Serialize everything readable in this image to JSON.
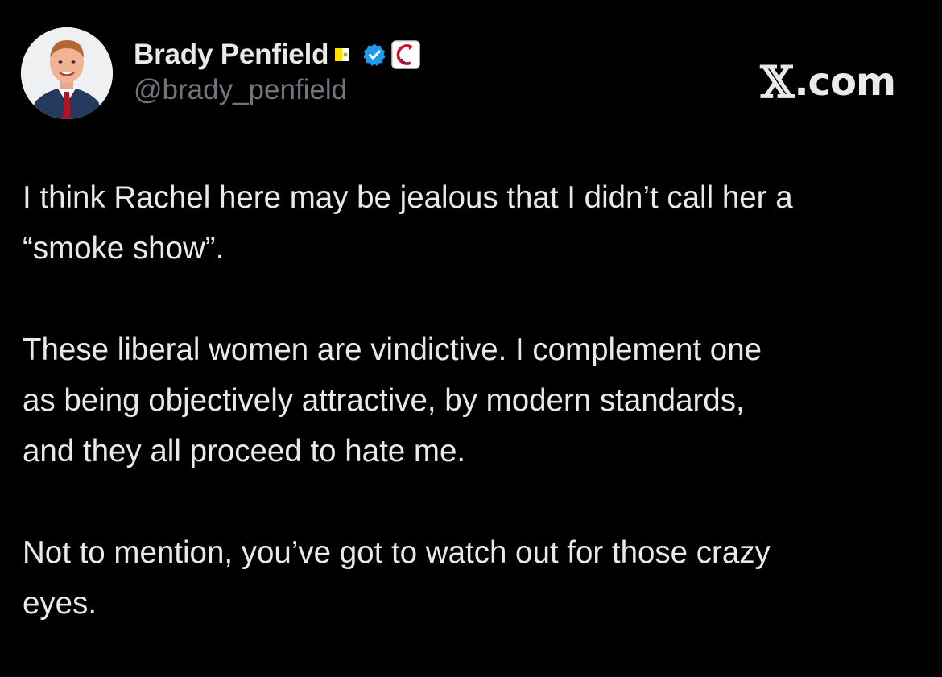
{
  "author": {
    "display_name": "Brady Penfield",
    "handle": "@brady_penfield",
    "avatar_icon": "profile-photo",
    "flag_icon": "vatican-flag-icon",
    "verified_icon": "verified-badge-icon",
    "affiliate_icon": "affiliate-logo-icon"
  },
  "brand": {
    "x_mark": "𝕏",
    "suffix": ".com"
  },
  "tweet": {
    "paragraphs": [
      "I think Rachel here may be jealous that I didn’t call her a\n“smoke show”.",
      "These liberal women are vindictive. I complement one\nas being objectively attractive, by modern standards,\nand they all proceed to hate me.",
      "Not to mention, you’ve got to watch out for those crazy\neyes."
    ]
  },
  "colors": {
    "background": "#000000",
    "text_primary": "#e7e9ea",
    "text_secondary": "#71767b",
    "verified_blue": "#1d9bf0",
    "affiliate_red": "#c8102e"
  }
}
